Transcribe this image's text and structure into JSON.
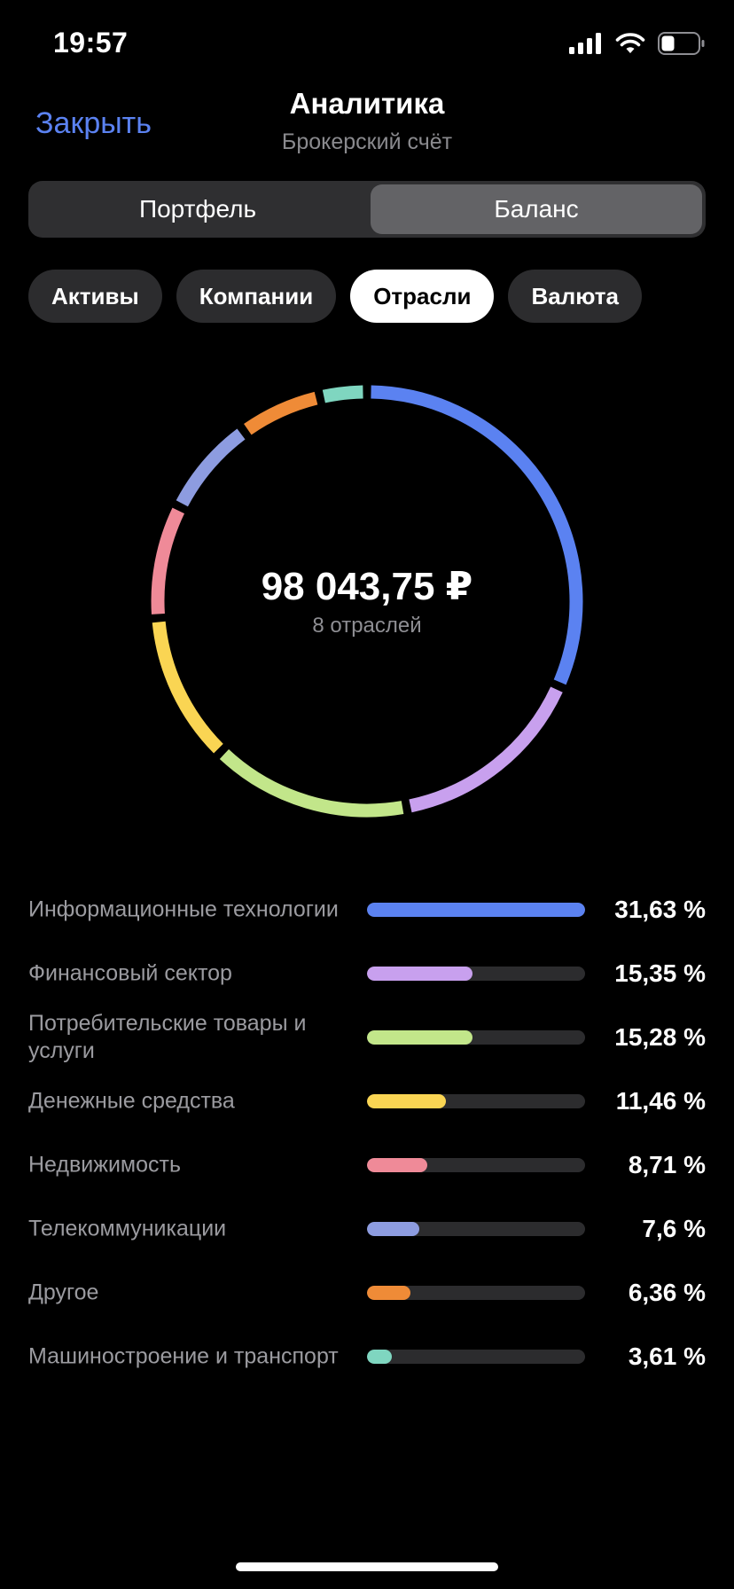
{
  "status_bar": {
    "time": "19:57"
  },
  "header": {
    "close_label": "Закрыть",
    "title": "Аналитика",
    "subtitle": "Брокерский счёт"
  },
  "segmented": {
    "items": [
      "Портфель",
      "Баланс"
    ],
    "selected": "Баланс"
  },
  "filters": {
    "items": [
      "Активы",
      "Компании",
      "Отрасли",
      "Валюта"
    ],
    "selected": "Отрасли"
  },
  "summary": {
    "total": "98 043,75 ₽",
    "count_label": "8 отраслей"
  },
  "sectors": [
    {
      "label": "Информационные технологии",
      "pct_text": "31,63 %",
      "value": 31.63,
      "color": "#5b82f1"
    },
    {
      "label": "Финансовый сектор",
      "pct_text": "15,35 %",
      "value": 15.35,
      "color": "#c8a0ee"
    },
    {
      "label": "Потребительские товары и услуги",
      "pct_text": "15,28 %",
      "value": 15.28,
      "color": "#c2e68a"
    },
    {
      "label": "Денежные средства",
      "pct_text": "11,46 %",
      "value": 11.46,
      "color": "#fad553"
    },
    {
      "label": "Недвижимость",
      "pct_text": "8,71 %",
      "value": 8.71,
      "color": "#ef8a98"
    },
    {
      "label": "Телекоммуникации",
      "pct_text": "7,6 %",
      "value": 7.6,
      "color": "#8d9ce0"
    },
    {
      "label": "Другое",
      "pct_text": "6,36 %",
      "value": 6.36,
      "color": "#ef8b37"
    },
    {
      "label": "Машиностроение и транспорт",
      "pct_text": "3,61 %",
      "value": 3.61,
      "color": "#7fd6c0"
    }
  ]
}
